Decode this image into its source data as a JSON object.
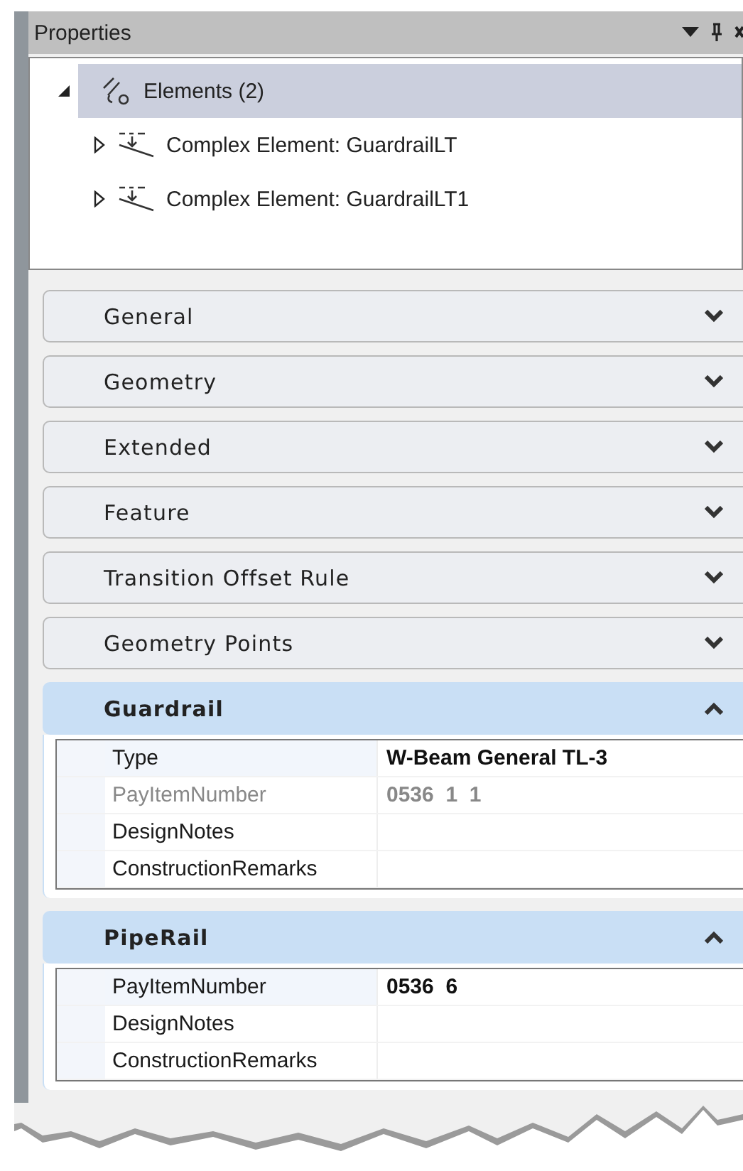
{
  "panel": {
    "title": "Properties"
  },
  "tree": [
    {
      "label": "Elements (2)",
      "kind": "group",
      "expanded": true,
      "selected": true,
      "children": [
        {
          "label": "Complex Element: GuardrailLT",
          "kind": "complex",
          "expanded": false,
          "selected": false
        },
        {
          "label": "Complex Element: GuardrailLT1",
          "kind": "complex",
          "expanded": false,
          "selected": false
        }
      ]
    }
  ],
  "sections": [
    {
      "title": "General",
      "expanded": false
    },
    {
      "title": "Geometry",
      "expanded": false
    },
    {
      "title": "Extended",
      "expanded": false
    },
    {
      "title": "Feature",
      "expanded": false
    },
    {
      "title": "Transition Offset Rule",
      "expanded": false
    },
    {
      "title": "Geometry Points",
      "expanded": false
    },
    {
      "title": "Guardrail",
      "expanded": true,
      "rows": [
        {
          "label": "Type",
          "value": "W-Beam General TL-3",
          "disabled": false,
          "selected": true
        },
        {
          "label": "PayItemNumber",
          "value": "0536  1  1",
          "disabled": true,
          "selected": false
        },
        {
          "label": "DesignNotes",
          "disabled": false,
          "selected": false
        },
        {
          "label": "ConstructionRemarks",
          "disabled": false,
          "selected": false
        }
      ]
    },
    {
      "title": "PipeRail",
      "expanded": true,
      "rows": [
        {
          "label": "PayItemNumber",
          "value": "0536  6",
          "disabled": false,
          "selected": true
        },
        {
          "label": "DesignNotes",
          "disabled": false,
          "selected": false
        },
        {
          "label": "ConstructionRemarks",
          "disabled": false,
          "selected": false
        }
      ]
    }
  ]
}
